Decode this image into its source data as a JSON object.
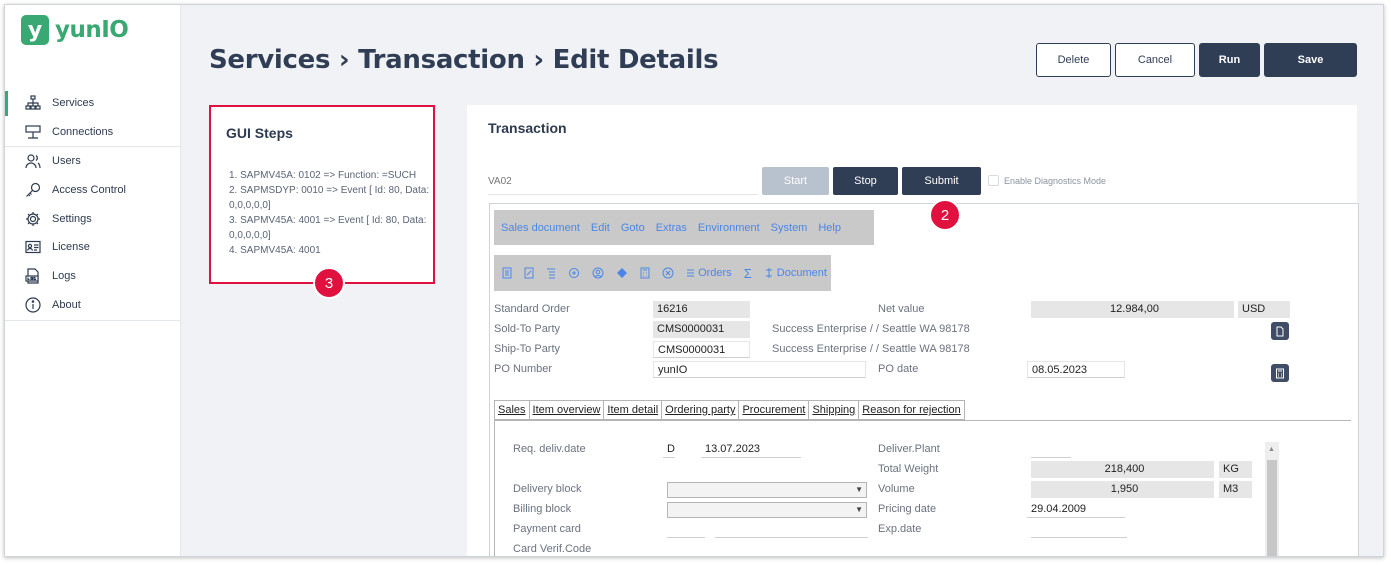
{
  "app": {
    "logo_letter": "y",
    "logo_name": "yunIO",
    "brand_color": "#3aa872"
  },
  "sidebar": {
    "items": [
      {
        "label": "Services",
        "icon": "sitemap-icon",
        "active": true
      },
      {
        "label": "Connections",
        "icon": "connection-icon"
      },
      {
        "label": "Users",
        "icon": "users-icon"
      },
      {
        "label": "Access Control",
        "icon": "key-icon"
      },
      {
        "label": "Settings",
        "icon": "gear-icon"
      },
      {
        "label": "License",
        "icon": "license-card-icon"
      },
      {
        "label": "Logs",
        "icon": "logs-icon"
      },
      {
        "label": "About",
        "icon": "info-icon"
      }
    ]
  },
  "header": {
    "title": "Services › Transaction › Edit Details",
    "delete_label": "Delete",
    "cancel_label": "Cancel",
    "run_label": "Run",
    "save_label": "Save"
  },
  "steps": {
    "title": "GUI Steps",
    "items": [
      "1. SAPMV45A: 0102 => Function: =SUCH",
      "2. SAPMSDYP: 0010 => Event [ Id: 80, Data: 0,0,0,0,0]",
      "3. SAPMV45A: 4001 => Event [ Id: 80, Data: 0,0,0,0,0]",
      "4. SAPMV45A: 4001"
    ],
    "badge": "3"
  },
  "transaction": {
    "title": "Transaction",
    "tcode_placeholder": "VA02",
    "start_label": "Start",
    "stop_label": "Stop",
    "submit_label": "Submit",
    "diagnostics_label": "Enable Diagnostics Mode",
    "badge": "2"
  },
  "sap": {
    "menu": [
      "Sales document",
      "Edit",
      "Goto",
      "Extras",
      "Environment",
      "System",
      "Help"
    ],
    "toolbar": {
      "orders_label": "Orders",
      "document_label": "Document",
      "sigma": "Σ"
    },
    "header_fields": {
      "standard_order_label": "Standard Order",
      "standard_order": "16216",
      "net_value_label": "Net value",
      "net_value": "12.984,00",
      "currency": "USD",
      "sold_to_label": "Sold-To Party",
      "sold_to": "CMS0000031",
      "sold_to_desc": "Success Enterprise / / Seattle WA 98178",
      "ship_to_label": "Ship-To Party",
      "ship_to": "CMS0000031",
      "ship_to_desc": "Success Enterprise / / Seattle WA 98178",
      "po_number_label": "PO Number",
      "po_number": "yunIO",
      "po_date_label": "PO date",
      "po_date": "08.05.2023"
    },
    "tabs": [
      "Sales",
      "Item overview",
      "Item detail",
      "Ordering party",
      "Procurement",
      "Shipping",
      "Reason for rejection"
    ],
    "sales_tab": {
      "req_deliv_label": "Req. deliv.date",
      "req_deliv_unit": "D",
      "req_deliv": "13.07.2023",
      "deliver_plant_label": "Deliver.Plant",
      "total_weight_label": "Total Weight",
      "total_weight": "218,400",
      "weight_unit": "KG",
      "delivery_block_label": "Delivery block",
      "volume_label": "Volume",
      "volume": "1,950",
      "volume_unit": "M3",
      "billing_block_label": "Billing block",
      "pricing_date_label": "Pricing date",
      "pricing_date": "29.04.2009",
      "payment_card_label": "Payment card",
      "exp_date_label": "Exp.date",
      "card_verif_label": "Card Verif.Code"
    }
  }
}
